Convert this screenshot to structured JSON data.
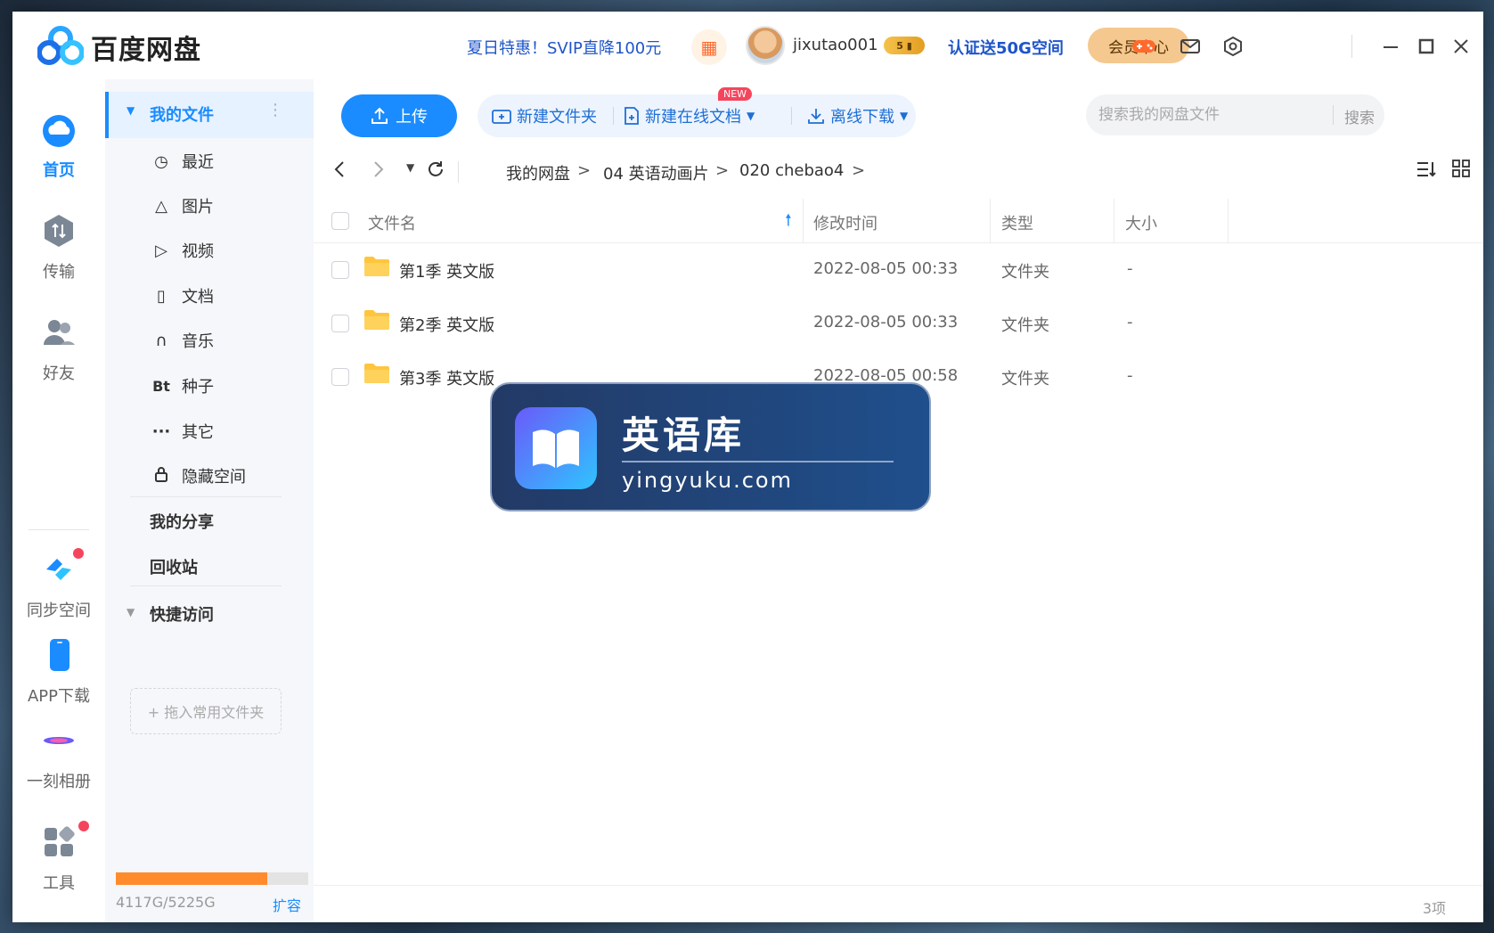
{
  "app": {
    "title": "百度网盘",
    "promo": "夏日特惠！SVIP直降100元",
    "username": "jixutao001",
    "vip_level": "5",
    "verify_promo": "认证送50G空间",
    "member_center": "会员中心"
  },
  "rail": {
    "items": [
      {
        "label": "首页",
        "icon": "home-cloud-icon"
      },
      {
        "label": "传输",
        "icon": "transfer-icon"
      },
      {
        "label": "好友",
        "icon": "friends-icon"
      },
      {
        "label": "同步空间",
        "icon": "sync-space-icon"
      },
      {
        "label": "APP下载",
        "icon": "app-download-icon"
      },
      {
        "label": "一刻相册",
        "icon": "album-icon"
      },
      {
        "label": "工具",
        "icon": "tools-icon"
      }
    ]
  },
  "sidebar": {
    "my_files": "我的文件",
    "items": [
      {
        "label": "最近",
        "icon": "clock-icon"
      },
      {
        "label": "图片",
        "icon": "image-icon"
      },
      {
        "label": "视频",
        "icon": "play-icon"
      },
      {
        "label": "文档",
        "icon": "document-icon"
      },
      {
        "label": "音乐",
        "icon": "headphones-icon"
      },
      {
        "label": "种子",
        "icon": "bt-icon"
      },
      {
        "label": "其它",
        "icon": "more-icon"
      },
      {
        "label": "隐藏空间",
        "icon": "lock-icon"
      }
    ],
    "my_share": "我的分享",
    "recycle": "回收站",
    "quick_access": "快捷访问",
    "drop_hint": "+ 拖入常用文件夹",
    "quota_text": "4117G/5225G",
    "quota_used_fraction": 0.788,
    "expand": "扩容"
  },
  "toolbar": {
    "upload": "上传",
    "new_folder": "新建文件夹",
    "new_online_doc": "新建在线文档",
    "new_badge": "NEW",
    "offline_download": "离线下载",
    "search_placeholder": "搜索我的网盘文件",
    "search_button": "搜索"
  },
  "breadcrumb": [
    "我的网盘",
    "04 英语动画片",
    "020 chebao4"
  ],
  "table": {
    "columns": [
      "文件名",
      "修改时间",
      "类型",
      "大小"
    ],
    "rows": [
      {
        "name": "第1季 英文版",
        "modified": "2022-08-05 00:33",
        "type": "文件夹",
        "size": "-"
      },
      {
        "name": "第2季 英文版",
        "modified": "2022-08-05 00:33",
        "type": "文件夹",
        "size": "-"
      },
      {
        "name": "第3季 英文版",
        "modified": "2022-08-05 00:58",
        "type": "文件夹",
        "size": "-"
      }
    ]
  },
  "watermark": {
    "title": "英语库",
    "url": "yingyuku.com"
  },
  "footer": {
    "count": "3项"
  },
  "colors": {
    "accent": "#1a8cff",
    "quota": "#ff8b2d",
    "folder": "#ffc53d",
    "badge": "#f5455c"
  }
}
